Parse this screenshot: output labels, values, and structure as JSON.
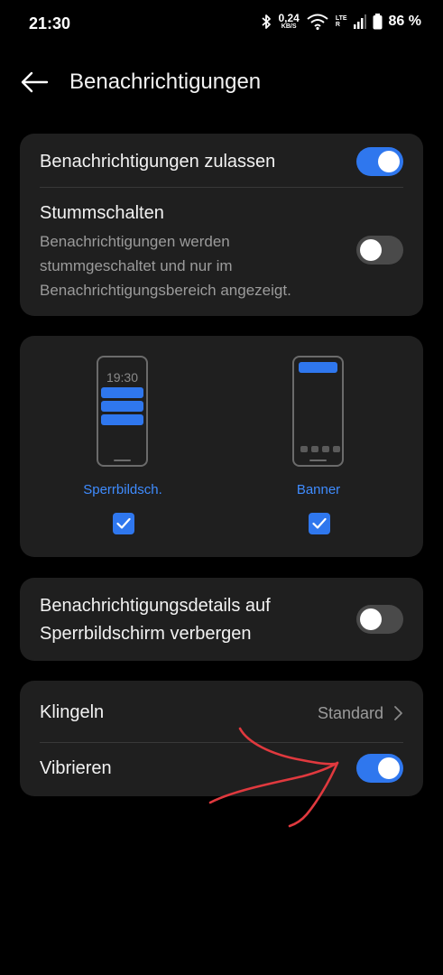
{
  "status_bar": {
    "time": "21:30",
    "speed_value": "0,24",
    "speed_unit": "KB/S",
    "network": "LTE",
    "network_sub": "R",
    "battery": "86 %"
  },
  "header": {
    "title": "Benachrichtigungen"
  },
  "notifications": {
    "allow_label": "Benachrichtigungen zulassen",
    "allow_on": true,
    "mute_label": "Stummschalten",
    "mute_description": "Benachrichtigungen werden stummgeschaltet und nur im Benachrichtigungsbereich angezeigt.",
    "mute_on": false
  },
  "styles": {
    "lock_time": "19:30",
    "lockscreen_label": "Sperrbildsch.",
    "lockscreen_checked": true,
    "banner_label": "Banner",
    "banner_checked": true
  },
  "details": {
    "hide_label": "Benachrichtigungsdetails auf Sperrbildschirm verbergen",
    "hide_on": false
  },
  "sound": {
    "ring_label": "Klingeln",
    "ring_value": "Standard",
    "vibrate_label": "Vibrieren",
    "vibrate_on": true
  },
  "colors": {
    "accent": "#2f77ee",
    "card": "#1f1f1f",
    "annotation": "#e0393e"
  }
}
